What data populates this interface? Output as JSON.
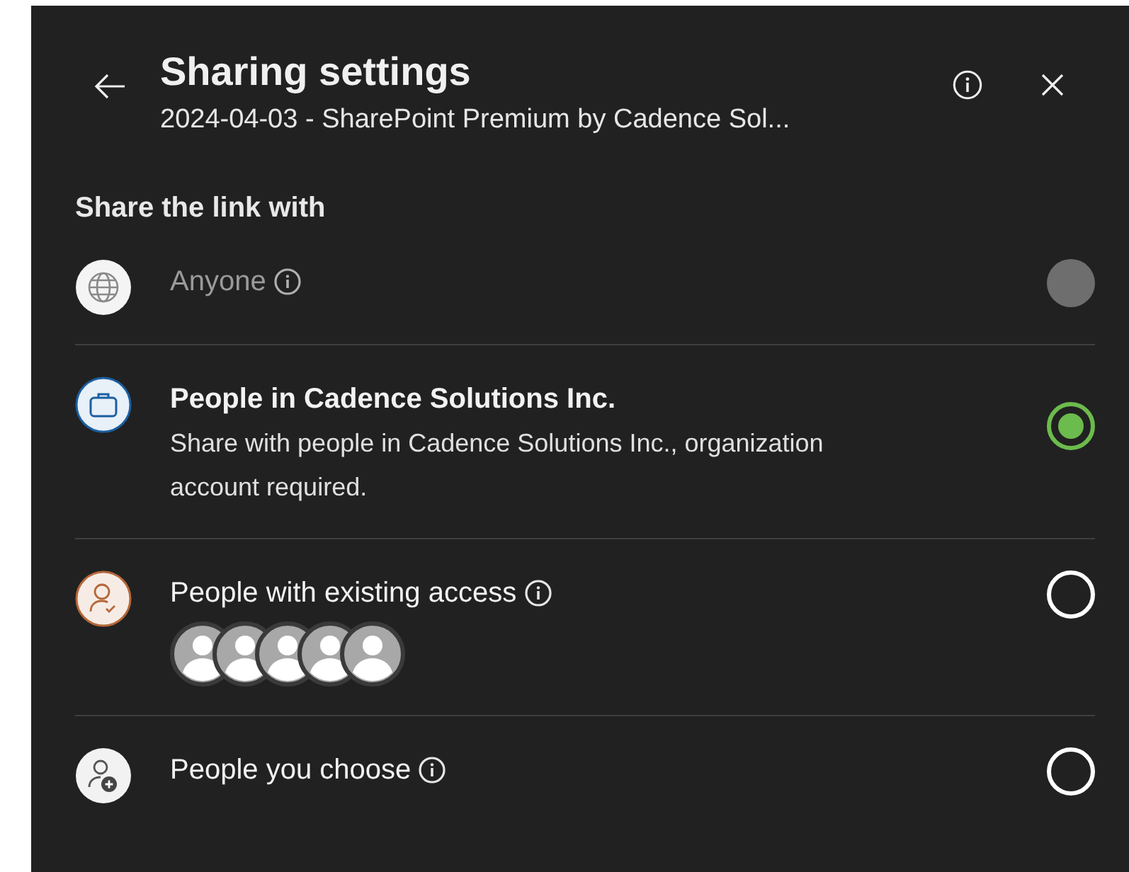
{
  "header": {
    "title": "Sharing settings",
    "subtitle": "2024-04-03 - SharePoint Premium by Cadence Sol..."
  },
  "section_title": "Share the link with",
  "options": [
    {
      "kind": "globe",
      "title": "Anyone",
      "info": true,
      "disabled": true,
      "selected": false
    },
    {
      "kind": "organization",
      "title": "People in Cadence Solutions Inc.",
      "description": "Share with people in Cadence Solutions Inc., organization account required.",
      "info": false,
      "disabled": false,
      "selected": true
    },
    {
      "kind": "existing",
      "title": "People with existing access",
      "info": true,
      "disabled": false,
      "selected": false,
      "avatars": [
        {
          "kind": "person"
        },
        {
          "kind": "person"
        },
        {
          "kind": "person"
        },
        {
          "kind": "person"
        },
        {
          "kind": "person"
        }
      ]
    },
    {
      "kind": "choose",
      "title": "People you choose",
      "info": true,
      "disabled": false,
      "selected": false
    }
  ]
}
